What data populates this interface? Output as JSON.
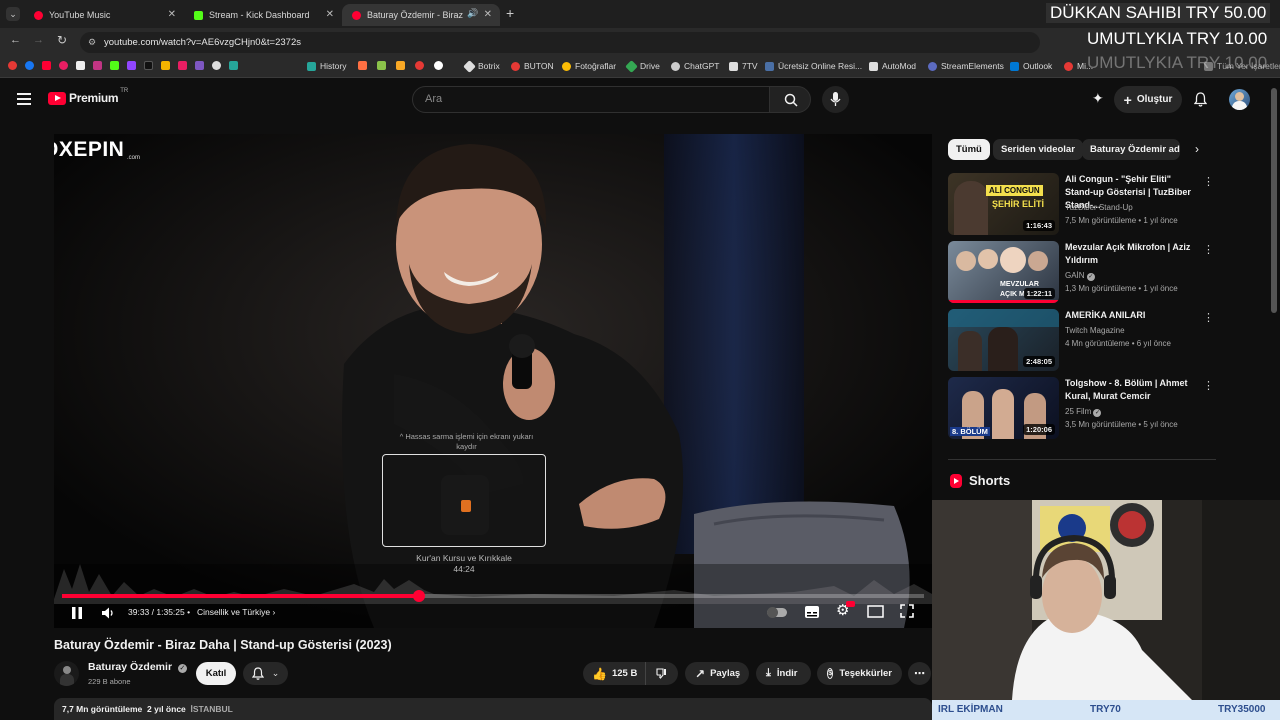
{
  "browser": {
    "tabs": [
      {
        "label": "YouTube Music",
        "color": "#ff0033"
      },
      {
        "label": "Stream - Kick Dashboard",
        "color": "#53fc18"
      },
      {
        "label": "Baturay Özdemir - Biraz Da",
        "color": "#ff0033"
      }
    ],
    "url": "youtube.com/watch?v=AE6vzgCHjn0&t=2372s",
    "bookmarks": [
      "History",
      "Botrix",
      "BUTON",
      "Fotoğraflar",
      "Drive",
      "ChatGPT",
      "7TV",
      "Ücretsiz Online Resi...",
      "AutoMod",
      "StreamElements",
      "Outlook",
      "Mi...",
      "Tüm Yer İşaretleri"
    ]
  },
  "header": {
    "logo_label": "Premium",
    "logo_region": "TR",
    "search_placeholder": "Ara",
    "create_label": "Oluştur"
  },
  "player": {
    "watermark": "FOXEPIN",
    "watermark_sub": ".com",
    "seek_hint": "Hassas sarma işlemi için ekranı yukarı kaydır",
    "preview_chapter": "Kur'an Kursu ve Kırıkkale",
    "preview_time": "44:24",
    "time_current": "39:33",
    "time_total": "1:35:25",
    "chapter": "Cinsellik ve Türkiye",
    "progress_fraction": 0.414
  },
  "video": {
    "title": "Baturay Özdemir - Biraz Daha | Stand-up Gösterisi (2023)",
    "channel": "Baturay Özdemir",
    "subscribers": "229 B abone",
    "join_label": "Katıl",
    "likes": "125 B",
    "share_label": "Paylaş",
    "download_label": "İndir",
    "thanks_label": "Teşekkürler",
    "views": "7,7 Mn görüntüleme",
    "age": "2 yıl önce",
    "tag": "İSTANBUL"
  },
  "sidebar": {
    "chips": [
      "Tümü",
      "Seriden videolar",
      "Baturay Özdemir adlı"
    ],
    "recommendations": [
      {
        "title": "Ali Congun - \"Şehir Eliti\" Stand-up Gösterisi | TuzBiber Stand-...",
        "channel": "TuzBiber Stand-Up",
        "meta": "7,5 Mn görüntüleme • 1 yıl önce",
        "duration": "1:16:43",
        "thumb_text": "ALİ CONGUN",
        "thumb_text2": "ŞEHİR ELİTİ"
      },
      {
        "title": "Mevzular Açık Mikrofon | Aziz Yıldırım",
        "channel": "GAİN",
        "meta": "1,3 Mn görüntüleme • 1 yıl önce",
        "duration": "1:22:11",
        "thumb_text": "MEVZULAR",
        "thumb_text2": "AÇIK M"
      },
      {
        "title": "AMERİKA ANILARI",
        "channel": "Twitch Magazine",
        "meta": "4 Mn görüntüleme • 6 yıl önce",
        "duration": "2:48:05",
        "thumb_text": "",
        "thumb_text2": ""
      },
      {
        "title": "Tolgshow - 8. Bölüm | Ahmet Kural, Murat Cemcir",
        "channel": "25 Film",
        "meta": "3,5 Mn görüntüleme • 5 yıl önce",
        "duration": "1:20:06",
        "thumb_text": "8. BÖLÜM",
        "thumb_text2": ""
      }
    ],
    "shorts_label": "Shorts"
  },
  "stream_overlay": {
    "line1": "DÜKKAN SAHIBI  TRY 50.00",
    "line2": "UMUTLYKIA  TRY 10.00",
    "line3": "UMUTLYKIA  TRY 10.00",
    "cam_footer_left": "IRL EKİPMAN",
    "cam_footer_mid": "TRY70",
    "cam_footer_right": "TRY35000"
  }
}
